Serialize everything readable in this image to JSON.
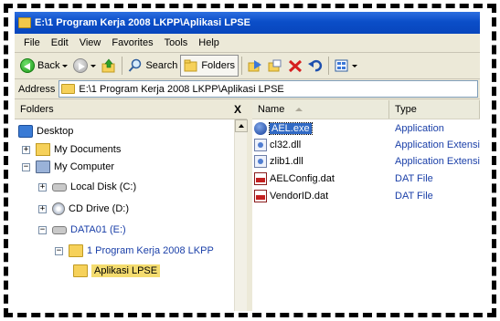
{
  "window": {
    "title": "E:\\1 Program Kerja 2008 LKPP\\Aplikasi LPSE"
  },
  "menu": [
    {
      "label": "File"
    },
    {
      "label": "Edit"
    },
    {
      "label": "View"
    },
    {
      "label": "Favorites"
    },
    {
      "label": "Tools"
    },
    {
      "label": "Help"
    }
  ],
  "toolbar": {
    "back_label": "Back",
    "search_label": "Search",
    "folders_label": "Folders"
  },
  "address": {
    "label": "Address",
    "value": "E:\\1 Program Kerja 2008 LKPP\\Aplikasi LPSE"
  },
  "folders_pane": {
    "title": "Folders",
    "close_label": "X",
    "tree": [
      {
        "label": "Desktop",
        "expander": ""
      },
      {
        "label": "My Documents",
        "expander": "+"
      },
      {
        "label": "My Computer",
        "expander": "−"
      },
      {
        "label": "Local Disk (C:)",
        "expander": "+"
      },
      {
        "label": "CD Drive (D:)",
        "expander": "+"
      },
      {
        "label": "DATA01 (E:)",
        "expander": "−"
      },
      {
        "label": "1 Program Kerja 2008 LKPP",
        "expander": "−"
      },
      {
        "label": "Aplikasi LPSE",
        "expander": ""
      }
    ]
  },
  "files_pane": {
    "columns": {
      "name": "Name",
      "type": "Type"
    },
    "rows": [
      {
        "name": "AEL.exe",
        "type": "Application",
        "icon": "exe-icon"
      },
      {
        "name": "cl32.dll",
        "type": "Application Extension",
        "icon": "dll-icon"
      },
      {
        "name": "zlib1.dll",
        "type": "Application Extension",
        "icon": "dll-icon"
      },
      {
        "name": "AELConfig.dat",
        "type": "DAT File",
        "icon": "dat-icon"
      },
      {
        "name": "VendorID.dat",
        "type": "DAT File",
        "icon": "dat-icon"
      }
    ]
  }
}
